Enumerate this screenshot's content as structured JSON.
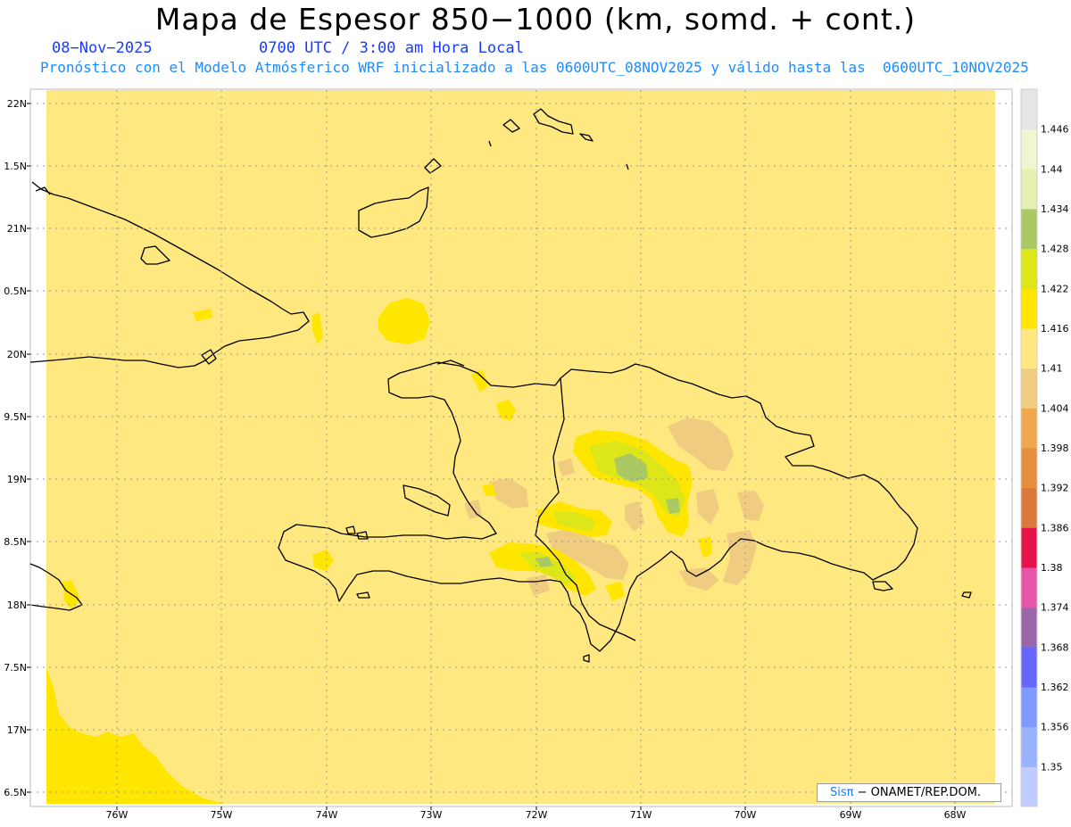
{
  "header": {
    "title": "Mapa de Espesor 850−1000 (km, somd. + cont.)",
    "date": "08−Nov−2025",
    "time": "0700 UTC / 3:00 am Hora Local",
    "subtitle": "Pronóstico con el Modelo Atmósferico WRF inicializado a las 0600UTC_08NOV2025 y válido hasta las  0600UTC_10NOV2025"
  },
  "credit": {
    "brand": "Sisπ",
    "text": "− ONAMET/REP.DOM."
  },
  "colors": {
    "background_field": "#ffe880",
    "land_outline": "#000000",
    "grid": "#9a9a9a"
  },
  "chart_data": {
    "type": "map",
    "lon_range": [
      -76.65,
      -67.6
    ],
    "lat_range": [
      16.45,
      22.1
    ],
    "lon_ticks": [
      "76W",
      "75W",
      "74W",
      "73W",
      "72W",
      "71W",
      "70W",
      "69W",
      "68W"
    ],
    "lat_ticks": [
      "22N",
      "1.5N",
      "21N",
      "0.5N",
      "20N",
      "9.5N",
      "19N",
      "8.5N",
      "18N",
      "7.5N",
      "17N",
      "6.5N"
    ],
    "colorbar": {
      "labels": [
        "1.446",
        "1.44",
        "1.434",
        "1.428",
        "1.422",
        "1.416",
        "1.41",
        "1.404",
        "1.398",
        "1.392",
        "1.386",
        "1.38",
        "1.374",
        "1.368",
        "1.362",
        "1.356",
        "1.35"
      ],
      "colors": [
        "#bfccff",
        "#99b3ff",
        "#7f99ff",
        "#6666ff",
        "#9966aa",
        "#e655aa",
        "#e6134a",
        "#dc783c",
        "#e88f3e",
        "#f0a84c",
        "#f0cc80",
        "#ffe880",
        "#ffe600",
        "#dce619",
        "#aac864",
        "#e6f0b4",
        "#f0f5d2",
        "#e6e6e6"
      ]
    },
    "field_levels": [
      {
        "name": "1.41-1.416",
        "color": "#ffe880"
      },
      {
        "name": "1.404-1.41",
        "color": "#f0cc80"
      },
      {
        "name": "1.416-1.422",
        "color": "#ffe600"
      },
      {
        "name": "1.422-1.428",
        "color": "#dce619"
      },
      {
        "name": "1.428-1.434",
        "color": "#aac864"
      }
    ]
  }
}
